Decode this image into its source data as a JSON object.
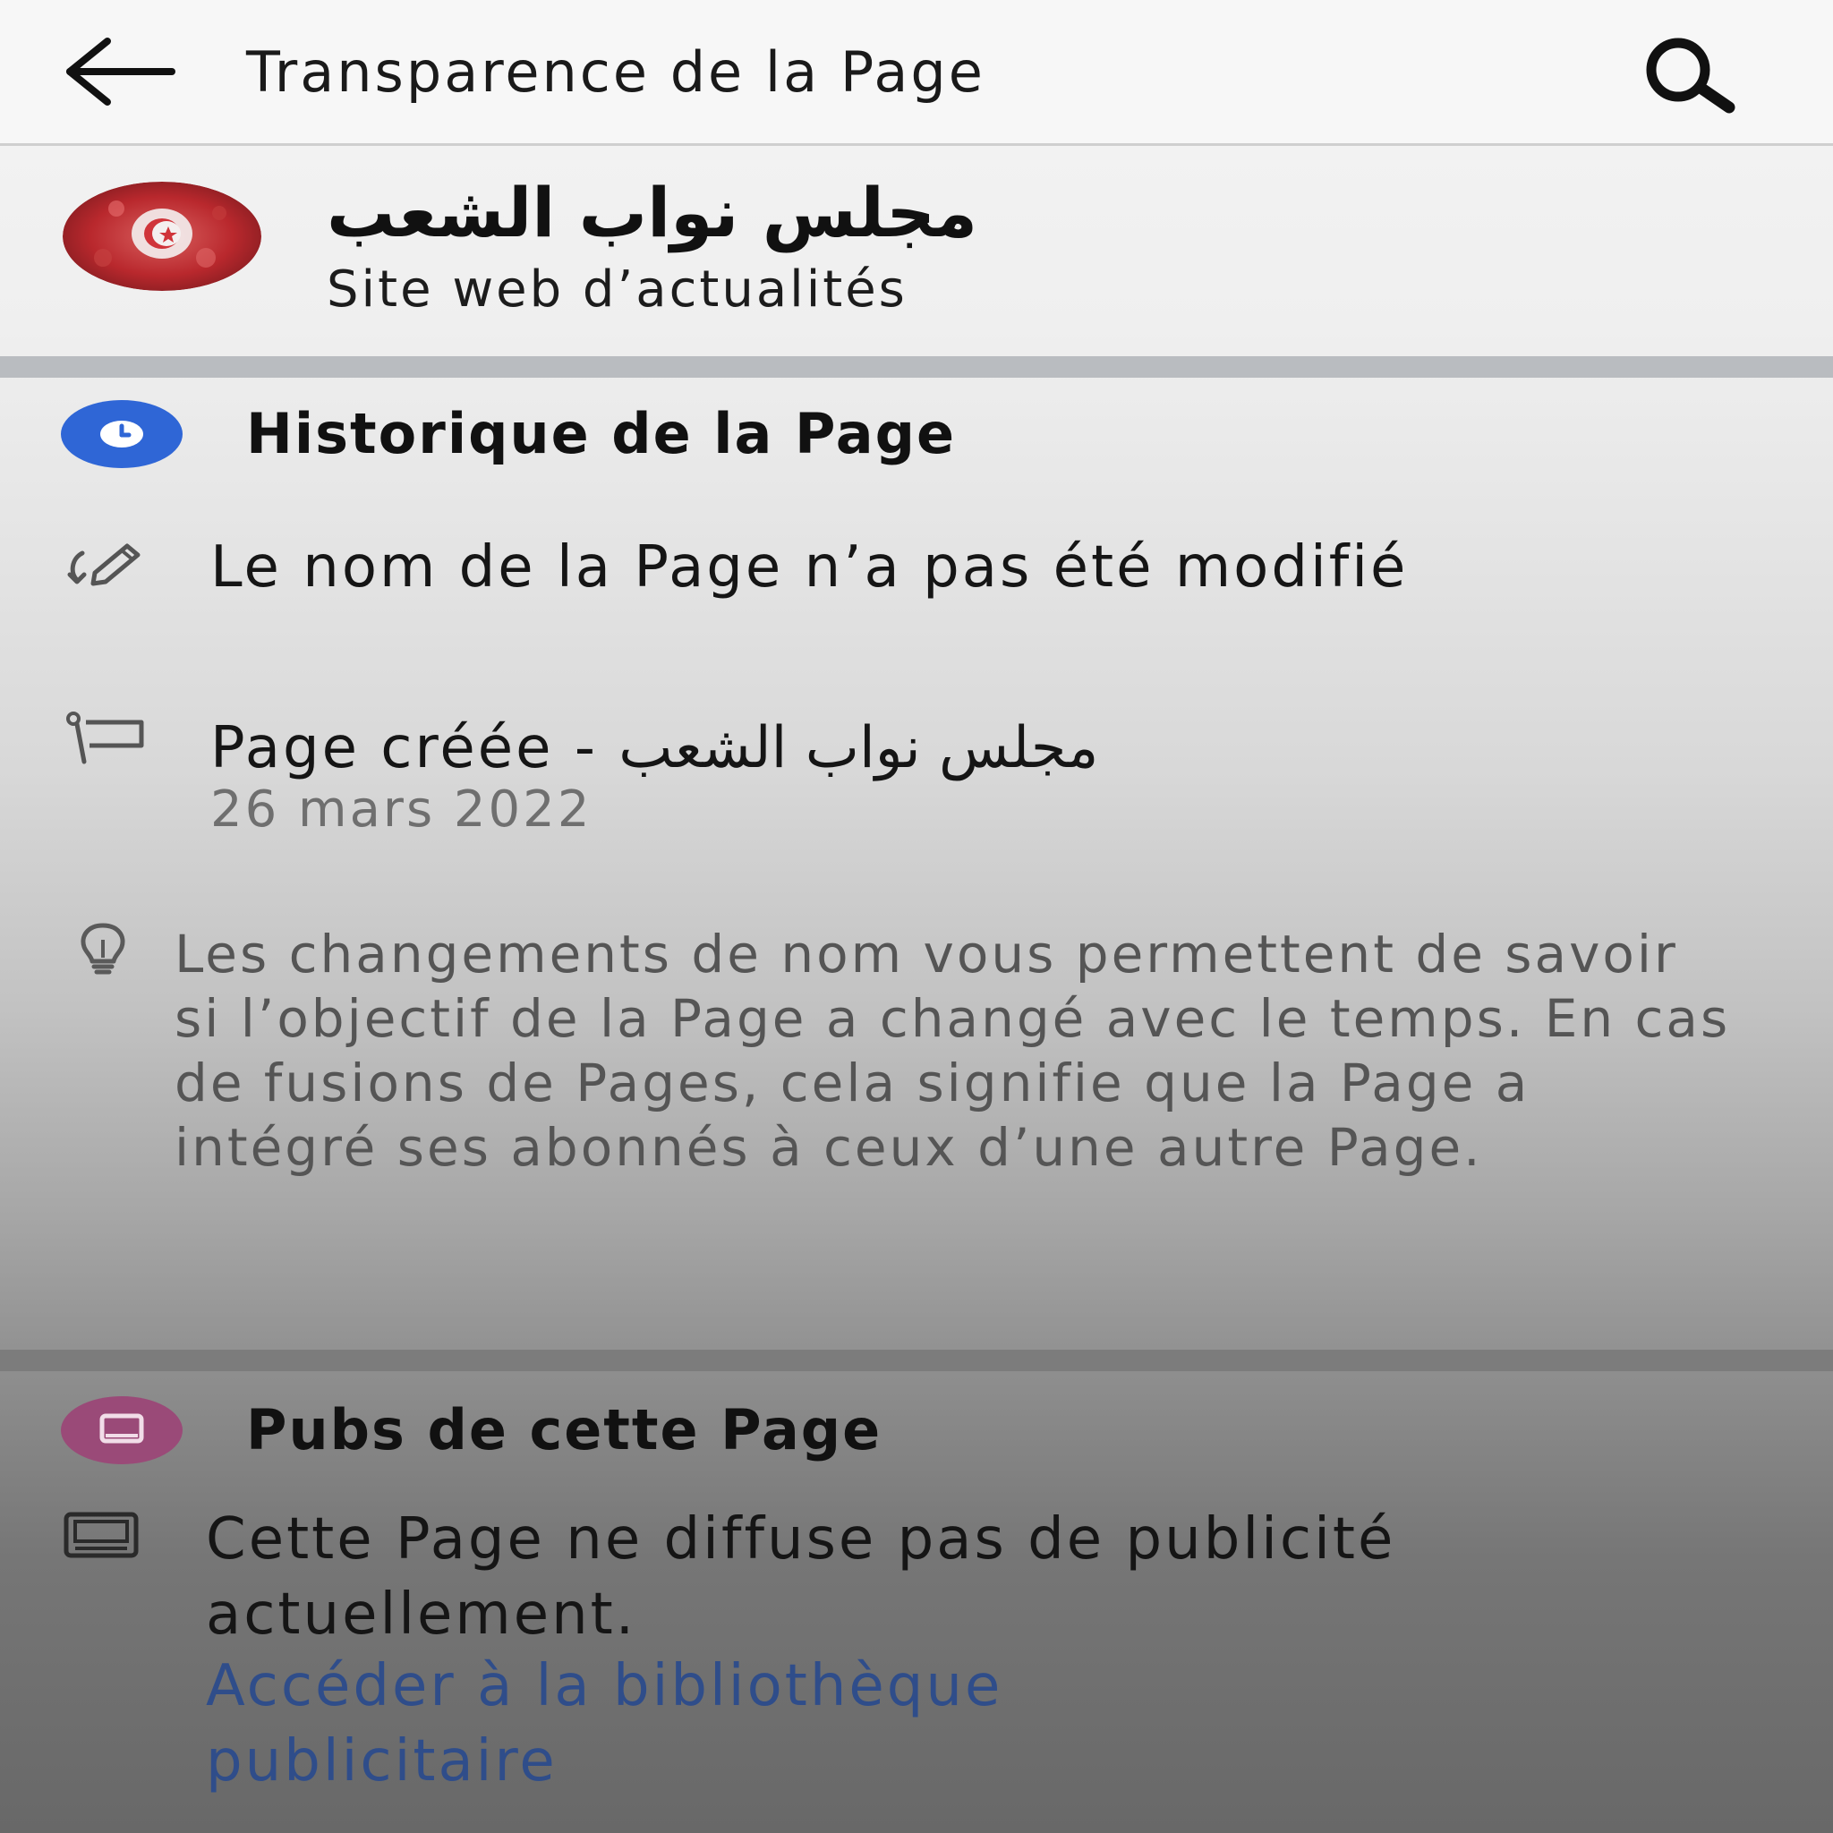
{
  "header": {
    "title": "Transparence de la Page"
  },
  "page": {
    "name": "مجلس نواب الشعب",
    "category": "Site web d’actualités"
  },
  "history": {
    "title": "Historique de la Page",
    "name_change_text": "Le nom de la Page n’a pas été modifié",
    "created_label": "Page créée -",
    "created_name": "مجلس نواب الشعب",
    "created_date": "26 mars 2022",
    "info_text": "Les changements de nom vous permettent de savoir si l’objectif de la Page a changé avec le temps. En cas de fusions de Pages, cela signifie que la Page a intégré ses abonnés à ceux d’une autre Page."
  },
  "ads": {
    "title": "Pubs de cette Page",
    "status_text": "Cette Page ne diffuse pas de publicité actuellement.",
    "library_link": "Accéder à la bibliothèque publicitaire"
  },
  "icons": {
    "back": "arrow-left-icon",
    "search": "search-icon",
    "history": "clock-icon",
    "name_change": "edit-name-icon",
    "created": "flag-icon",
    "info": "lightbulb-icon",
    "ads": "screen-icon",
    "ads_row": "screen-icon"
  },
  "colors": {
    "history_icon_bg": "#2f66d6",
    "ads_icon_bg": "#9a4a78",
    "link": "#2f4d8a"
  }
}
